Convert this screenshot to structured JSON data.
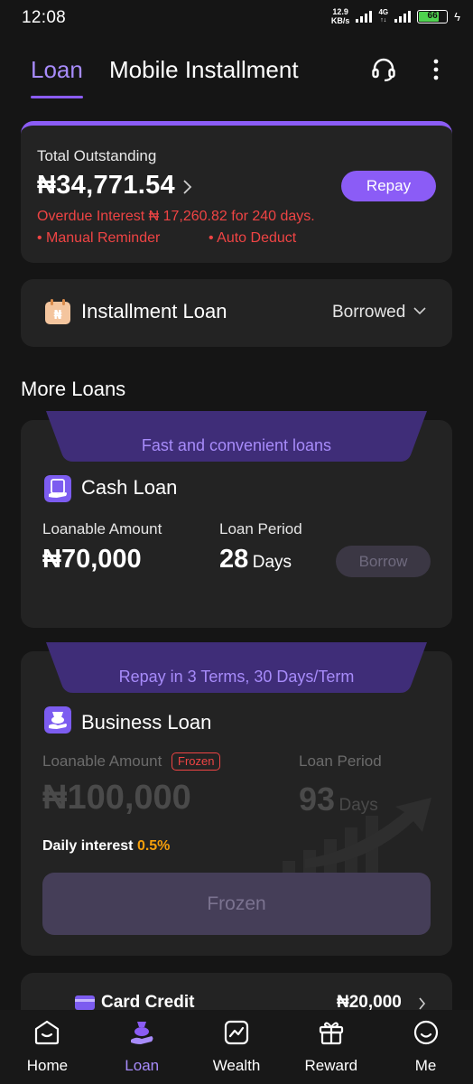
{
  "status_bar": {
    "time": "12:08",
    "net_speed_value": "12.9",
    "net_speed_unit": "KB/s",
    "network_type": "4G",
    "battery": "66"
  },
  "header": {
    "tab_active": "Loan",
    "tab_other": "Mobile Installment",
    "icons": [
      "headset-icon",
      "more-vertical-icon"
    ]
  },
  "outstanding": {
    "label": "Total Outstanding",
    "amount": "₦34,771.54",
    "repay_label": "Repay",
    "overdue": "Overdue Interest ₦ 17,260.82 for 240 days.",
    "manual_reminder": "• Manual Reminder",
    "auto_deduct": "• Auto Deduct"
  },
  "installment": {
    "label": "Installment Loan",
    "status": "Borrowed",
    "icon_glyph": "₦"
  },
  "more_loans_title": "More Loans",
  "cash_loan": {
    "banner": "Fast and convenient loans",
    "title": "Cash Loan",
    "amount_label": "Loanable Amount",
    "amount": "₦70,000",
    "period_label": "Loan Period",
    "period_num": "28",
    "period_unit": "Days",
    "button": "Borrow"
  },
  "business_loan": {
    "banner": "Repay in  3 Terms, 30  Days/Term",
    "title": "Business Loan",
    "amount_label": "Loanable Amount",
    "badge": "Frozen",
    "amount": "₦100,000",
    "period_label": "Loan Period",
    "period_num": "93",
    "period_unit": "Days",
    "daily_label": "Daily interest ",
    "daily_rate": "0.5%",
    "button": "Frozen"
  },
  "card_credit": {
    "title": "Card Credit",
    "amount": "₦20,000"
  },
  "bottom_nav": {
    "items": [
      {
        "label": "Home",
        "icon": "home-icon"
      },
      {
        "label": "Loan",
        "icon": "loan-icon",
        "active": true
      },
      {
        "label": "Wealth",
        "icon": "wealth-icon"
      },
      {
        "label": "Reward",
        "icon": "gift-icon"
      },
      {
        "label": "Me",
        "icon": "smile-icon"
      }
    ]
  },
  "colors": {
    "accent": "#8b5cf6",
    "accent_text": "#a78bfa",
    "danger": "#ef4444",
    "warning": "#f59e0b",
    "card_bg": "#232323",
    "page_bg": "#151515"
  }
}
